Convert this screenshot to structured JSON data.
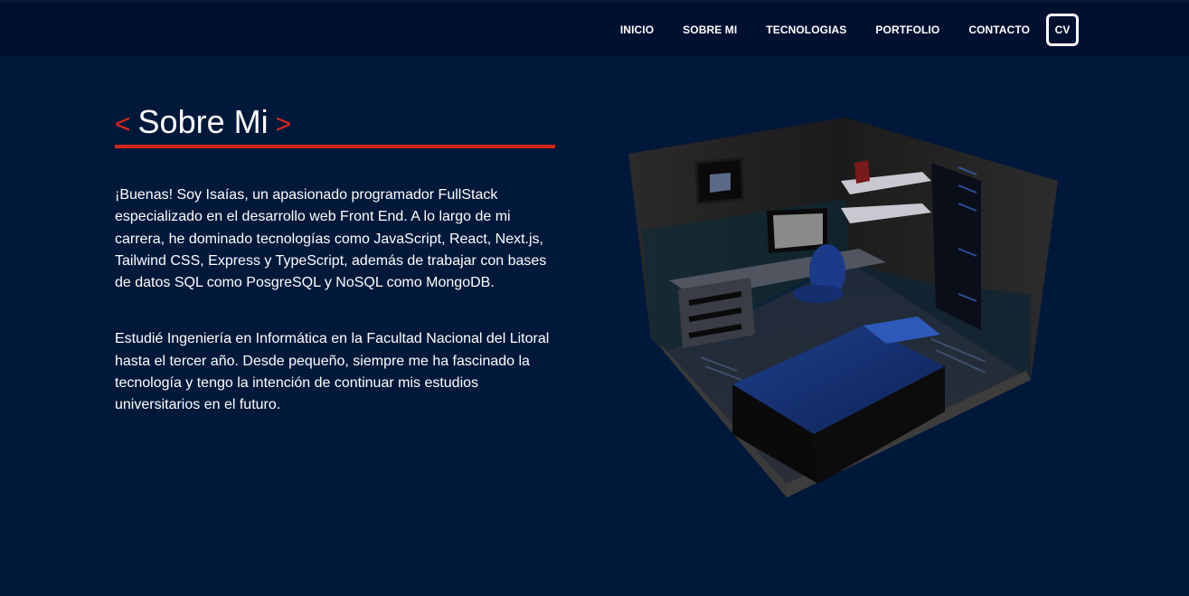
{
  "nav": {
    "items": [
      "INICIO",
      "SOBRE MI",
      "TECNOLOGIAS",
      "PORTFOLIO",
      "CONTACTO"
    ],
    "cv_label": "CV"
  },
  "about": {
    "bracket_open": "<",
    "title": "Sobre Mi",
    "bracket_close": ">",
    "paragraphs": [
      "¡Buenas! Soy Isaías, un apasionado programador FullStack especializado en el desarrollo web Front End. A lo largo de mi carrera, he dominado tecnologías como JavaScript, React, Next.js, Tailwind CSS, Express y TypeScript, además de trabajar con bases de datos SQL como PosgreSQL y NoSQL como MongoDB.",
      "Estudié Ingeniería en Informática en la Facultad Nacional del Litoral hasta el tercer año. Desde pequeño, siempre me ha fascinado la tecnología y tengo la intención de continuar mis estudios universitarios en el futuro."
    ]
  },
  "colors": {
    "background": "#00183a",
    "navbar": "#001130",
    "accent": "#d3261b",
    "text": "#ffffff"
  },
  "illustration": {
    "icon": "isometric-bedroom-3d-render"
  }
}
